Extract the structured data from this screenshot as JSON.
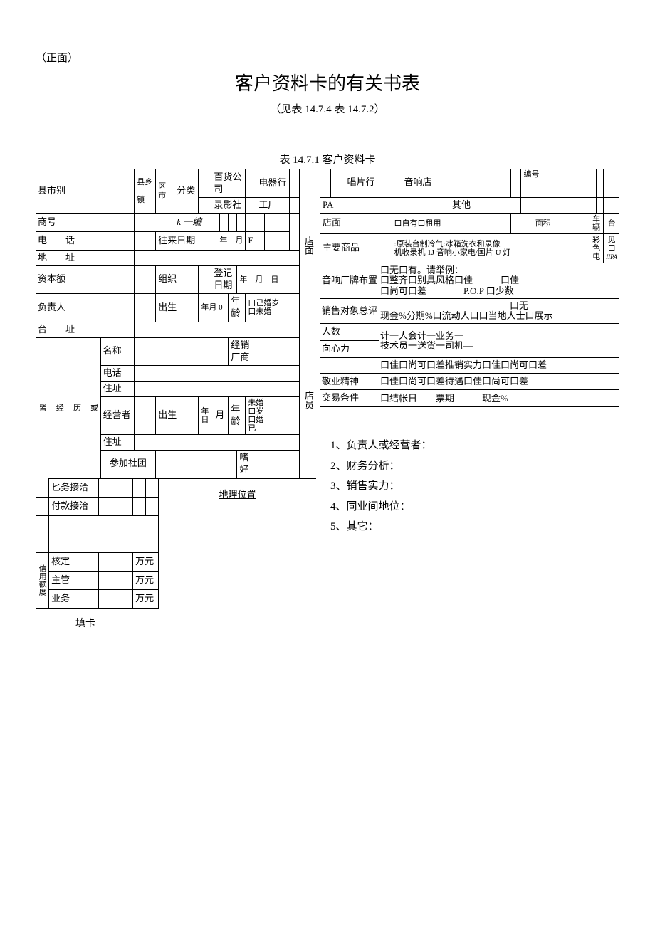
{
  "header": {
    "front": "（正面）",
    "title": "客户资料卡的有关书表",
    "subtitle": "（见表 14.7.4 表 14.7.2）",
    "table_label": "表 14.7.1 客户资料卡"
  },
  "left": {
    "county_city": "县市别",
    "county_township": "县乡",
    "town": "镇",
    "district_city": "区市",
    "category": "分类",
    "dept_store": "百货公司",
    "electrical": "电器行",
    "video_shop": "录影社",
    "factory": "工厂",
    "shop_name": "商号",
    "k_code": "k 一编",
    "phone": "电　　话",
    "visit_date": "往来日期",
    "year": "年",
    "month": "月",
    "e": "E",
    "address1": "地　　址",
    "capital": "资本额",
    "org": "组织",
    "register_date": "登记日期",
    "ymd": "年　月　日",
    "manager": "负责人",
    "birth": "出生",
    "ym0": "年月 0",
    "age": "年龄",
    "married_age": "口己婚岁",
    "unmarried": "口未婚",
    "tai_address": "台　　址",
    "side_or": "或",
    "name": "名称",
    "dealer": "经销厂商",
    "phone2": "电话",
    "side_history": "历",
    "res": "住址",
    "side_jing": "经",
    "operator": "经营者",
    "birth2": "出生",
    "year_day": "年日",
    "month2": "月",
    "age2": "年龄",
    "marriage_block": "未婚\n口岁\n口婚\n已",
    "side_jie": "皆",
    "res2": "住址",
    "club": "参加社团",
    "hobby": "嗜好",
    "biz_contact": "匕务接洽",
    "pay_contact": "付款接洽",
    "geo": "地理位置",
    "credit_side": "信用额度",
    "approved": "核定",
    "supervisor": "主管",
    "business": "业务",
    "wanyuan": "万元",
    "fill_card": "填卡",
    "store_side": "店面",
    "store_side2": "店员"
  },
  "right": {
    "record_shop": "唱片行",
    "audio_shop": "音响店",
    "serial": "编号",
    "pa": "PA",
    "other": "其他",
    "storefront": "店面",
    "own_rent": "口自有口租用",
    "area": "面积",
    "vehicles": "车辆",
    "unit": "台",
    "main_goods": "主要商品",
    "goods_line1": ":原装台制冷气:冰箱洗衣和录像",
    "goods_line2": "机收录机 1J 音响小家电/国片 U 灯",
    "color_tv": "彩色电",
    "see": "见",
    "kou": "口",
    "iipa": "IIPA",
    "brand_layout": "音响厂牌布置",
    "brand_line1": "口无口有。请举例：",
    "brand_line2": "口整齐口别具风格口佳　　　口佳",
    "brand_line3": "口尚可口差　　　　P.O.P 口少数",
    "sales_eval": "销售对象总评",
    "sales_line1": "　　　　　　　　　　　　　　口无",
    "sales_line2": "现金%分期%口流动人口口当地人士口展示",
    "people": "人数",
    "people_val": "计一人会计一业务一\n技术员一送货一司机—",
    "centripetal": "向心力",
    "centripetal_val": "口佳口尚可口差推销实力口佳口尚可口差",
    "dedication": "敬业精神",
    "dedication_val": "口佳口尚可口差待遇口佳口尚可口差",
    "trade_terms": "交易条件",
    "trade_val": "口结帐日　　票期　　　现金%"
  },
  "notes": {
    "n1": "1、负责人或经营者：",
    "n2": "2、财务分析：",
    "n3": "3、销售实力：",
    "n4": "4、同业间地位：",
    "n5": "5、其它："
  }
}
